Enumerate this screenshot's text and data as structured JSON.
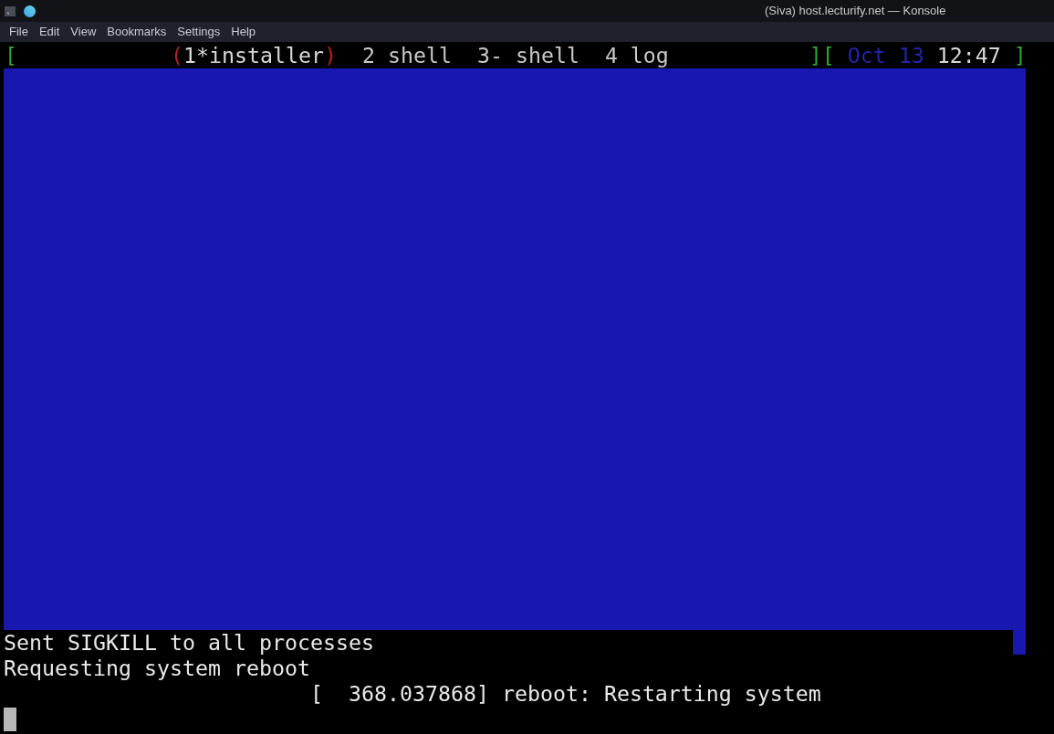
{
  "window": {
    "title": "(Siva) host.lecturify.net — Konsole"
  },
  "menu": [
    "File",
    "Edit",
    "View",
    "Bookmarks",
    "Settings",
    "Help"
  ],
  "tmux_status": {
    "open": "[",
    "selected_marks": [
      "(",
      ")"
    ],
    "windows": [
      {
        "label": "1*installer",
        "selected": true
      },
      {
        "label": "2 shell",
        "selected": false
      },
      {
        "label": "3- shell",
        "selected": false
      },
      {
        "label": "4 log",
        "selected": false
      }
    ],
    "divider": "][",
    "date": "Oct 13",
    "time": "12:47",
    "close": "]"
  },
  "terminal": {
    "lines": [
      {
        "kind": "plain",
        "text": "Sent SIGKILL to all processes"
      },
      {
        "kind": "plain",
        "text": "Requesting system reboot"
      },
      {
        "kind": "kernel",
        "text": "[  368.037868] reboot: Restarting system"
      }
    ],
    "cursor": true
  }
}
